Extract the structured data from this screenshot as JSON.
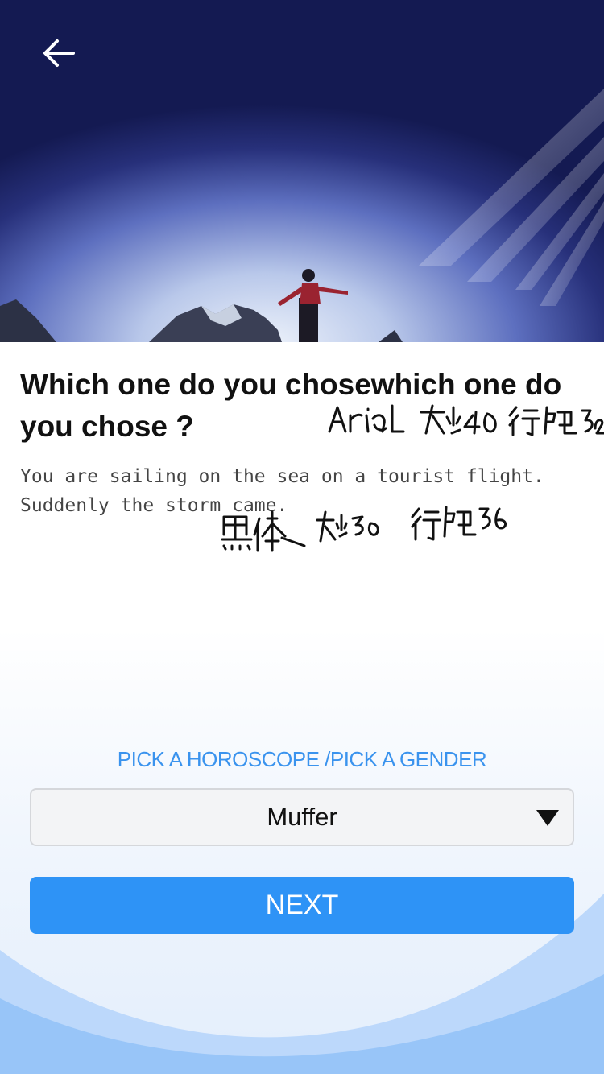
{
  "header": {
    "back_icon": "arrow-left-icon",
    "hero_image": "mountaineer-on-summit-under-light-beams"
  },
  "question": {
    "title": "Which one do you chosewhich one do you chose ?",
    "description": "You are sailing on the sea on a tourist flight.\nSuddenly the storm came."
  },
  "annotations": {
    "title_note": "Arial 大小40 行距52",
    "desc_note": "黑体 大小30 行距36"
  },
  "picker": {
    "label": "PICK A HOROSCOPE  /PICK A GENDER",
    "selected": "Muffer",
    "arrow_icon": "caret-down-icon"
  },
  "actions": {
    "next_label": "NEXT"
  },
  "colors": {
    "accent": "#2e93f6",
    "label_blue": "#3a93ee",
    "select_bg": "#f3f4f6"
  }
}
